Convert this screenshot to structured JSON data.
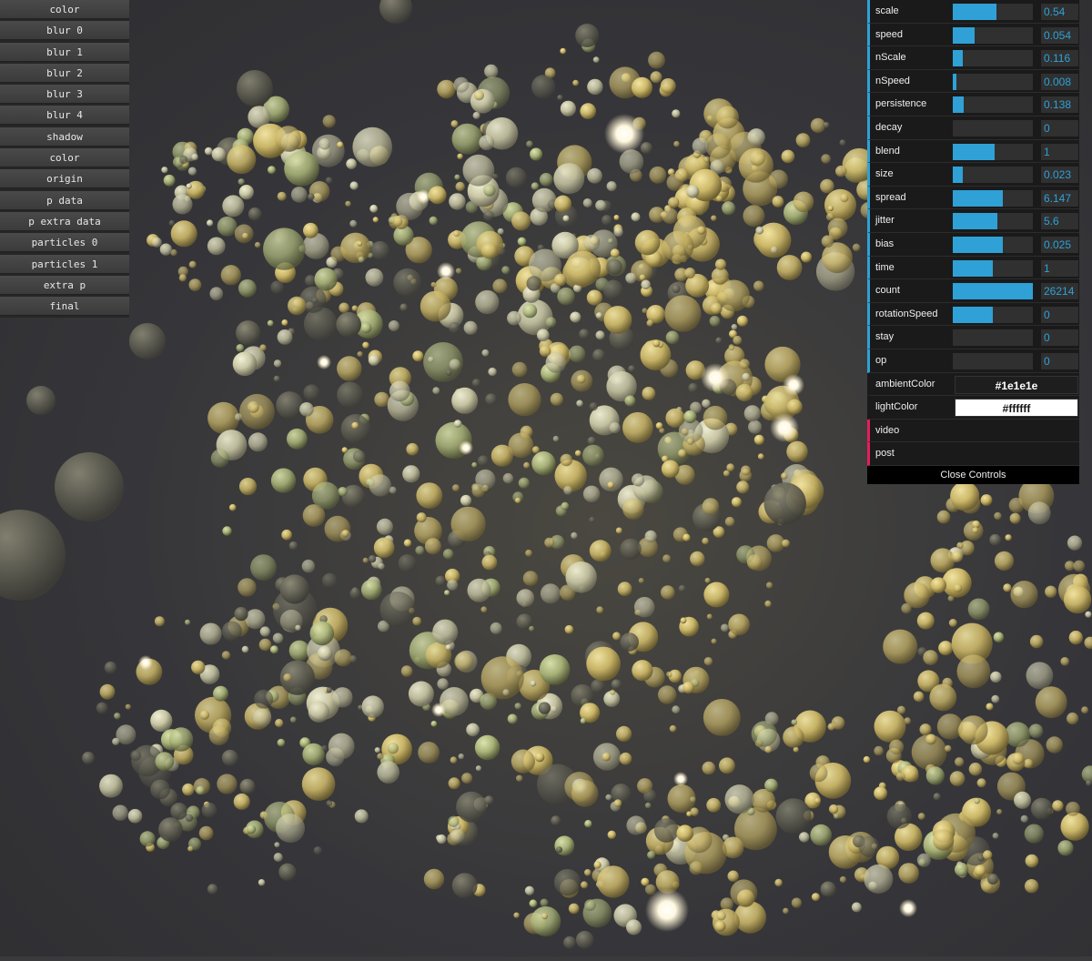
{
  "debug_buttons": [
    "color",
    "blur 0",
    "blur 1",
    "blur 2",
    "blur 3",
    "blur 4",
    "shadow",
    "color",
    "origin",
    "p data",
    "p extra data",
    "particles 0",
    "particles 1",
    "extra p",
    "final"
  ],
  "controls": {
    "sliders": [
      {
        "label": "scale",
        "value": "0.54",
        "fill": 0.54
      },
      {
        "label": "speed",
        "value": "0.054",
        "fill": 0.27
      },
      {
        "label": "nScale",
        "value": "0.116",
        "fill": 0.12
      },
      {
        "label": "nSpeed",
        "value": "0.008",
        "fill": 0.04
      },
      {
        "label": "persistence",
        "value": "0.138",
        "fill": 0.14
      },
      {
        "label": "decay",
        "value": "0",
        "fill": 0
      },
      {
        "label": "blend",
        "value": "1",
        "fill": 0.52
      },
      {
        "label": "size",
        "value": "0.023",
        "fill": 0.12
      },
      {
        "label": "spread",
        "value": "6.147",
        "fill": 0.62
      },
      {
        "label": "jitter",
        "value": "5.6",
        "fill": 0.56
      },
      {
        "label": "bias",
        "value": "0.025",
        "fill": 0.62
      },
      {
        "label": "time",
        "value": "1",
        "fill": 0.5
      },
      {
        "label": "count",
        "value": "26214",
        "fill": 1.0
      },
      {
        "label": "rotationSpeed",
        "value": "0",
        "fill": 0.5
      },
      {
        "label": "stay",
        "value": "0",
        "fill": 0
      },
      {
        "label": "op",
        "value": "0",
        "fill": 0
      }
    ],
    "colors": [
      {
        "label": "ambientColor",
        "value": "#1e1e1e",
        "bg": "#1e1e1e",
        "fg": "#ffffff"
      },
      {
        "label": "lightColor",
        "value": "#ffffff",
        "bg": "#ffffff",
        "fg": "#111111"
      }
    ],
    "folders": [
      "video",
      "post"
    ],
    "close_label": "Close Controls",
    "accent_color": "#2fa1d6",
    "folder_color": "#e61d5f"
  }
}
